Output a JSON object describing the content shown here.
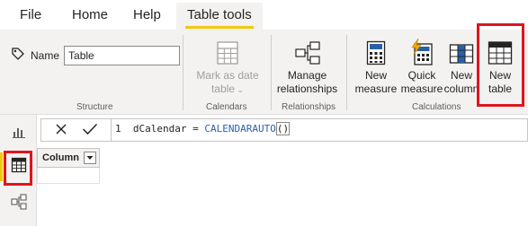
{
  "tabs": {
    "file": "File",
    "home": "Home",
    "help": "Help",
    "table_tools": "Table tools"
  },
  "structure": {
    "name_label": "Name",
    "name_value": "Table",
    "group_label": "Structure"
  },
  "calendars": {
    "mark_as_date_line1": "Mark as date",
    "mark_as_date_line2": "table",
    "group_label": "Calendars"
  },
  "relationships": {
    "manage_line1": "Manage",
    "manage_line2": "relationships",
    "group_label": "Relationships"
  },
  "calculations": {
    "new_measure_line1": "New",
    "new_measure_line2": "measure",
    "quick_measure_line1": "Quick",
    "quick_measure_line2": "measure",
    "new_column_line1": "New",
    "new_column_line2": "column",
    "new_table_line1": "New",
    "new_table_line2": "table",
    "group_label": "Calculations"
  },
  "formula": {
    "line_number": "1",
    "text_prefix": "dCalendar = ",
    "function_name": "CALENDARAUTO",
    "parens": "()"
  },
  "table": {
    "column_header": "Column"
  },
  "icons": {
    "tag": "tag-icon",
    "calendar": "calendar-table-icon",
    "relationships": "relationships-icon",
    "calculator": "calculator-icon",
    "quick": "quick-measure-icon",
    "column": "new-column-icon",
    "table": "new-table-icon",
    "report": "report-view-icon",
    "data": "data-view-icon",
    "model": "model-view-icon"
  },
  "colors": {
    "accent_yellow": "#f2c811",
    "highlight_red": "#e0141f",
    "ribbon_bg": "#f3f2f1"
  }
}
